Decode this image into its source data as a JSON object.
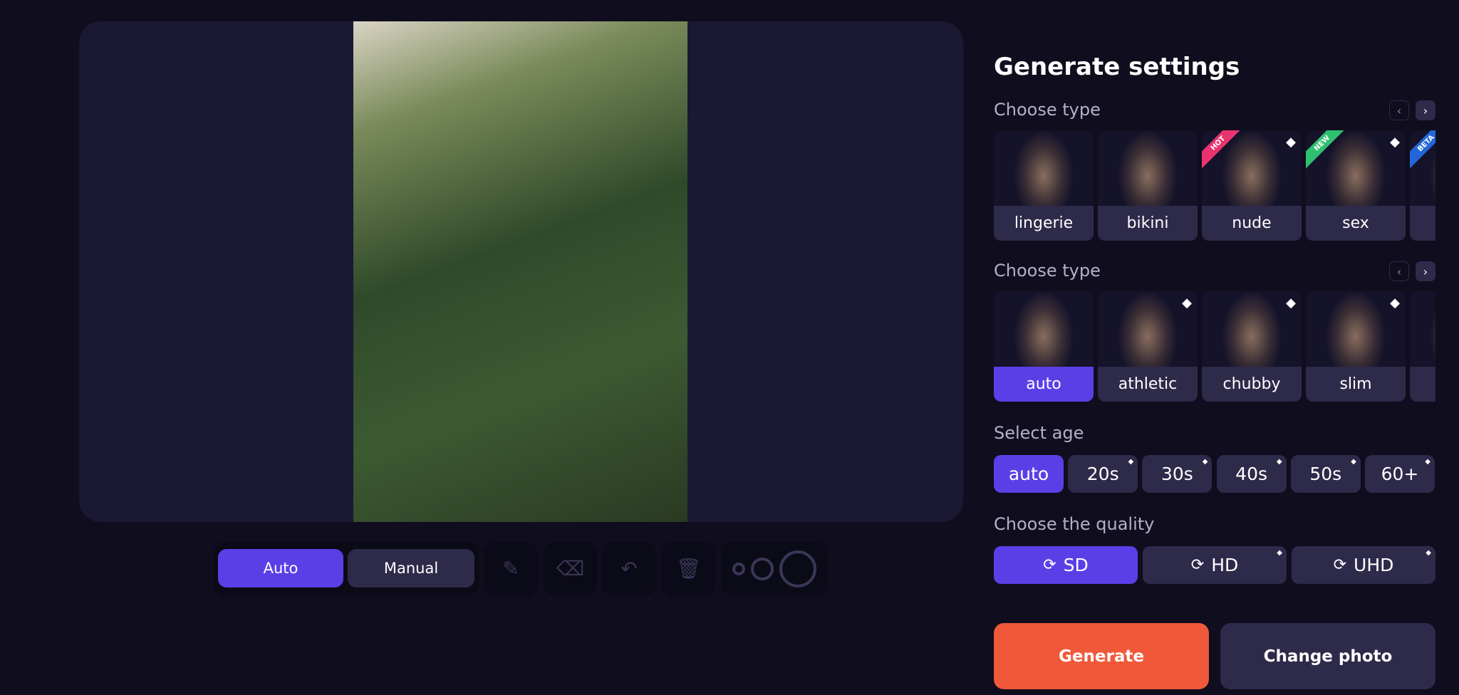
{
  "colors": {
    "accent": "#5b3fe6",
    "generate": "#f0583a",
    "hot": "#e8336f",
    "new": "#2fbf71",
    "beta": "#2266d8"
  },
  "editor": {
    "mode_auto": "Auto",
    "mode_manual": "Manual",
    "tools": [
      "brush-icon",
      "eraser-icon",
      "undo-icon",
      "trash-icon"
    ],
    "brush_sizes": [
      "small",
      "medium",
      "large"
    ]
  },
  "settings": {
    "title": "Generate settings",
    "type1": {
      "label": "Choose type",
      "items": [
        {
          "label": "lingerie",
          "premium": false,
          "badge": ""
        },
        {
          "label": "bikini",
          "premium": false,
          "badge": ""
        },
        {
          "label": "nude",
          "premium": true,
          "badge": "HOT"
        },
        {
          "label": "sex",
          "premium": true,
          "badge": "NEW"
        },
        {
          "label": "",
          "premium": false,
          "badge": "BETA"
        }
      ]
    },
    "type2": {
      "label": "Choose type",
      "selected": "auto",
      "items": [
        {
          "label": "auto",
          "premium": false
        },
        {
          "label": "athletic",
          "premium": true
        },
        {
          "label": "chubby",
          "premium": true
        },
        {
          "label": "slim",
          "premium": true
        },
        {
          "label": "",
          "premium": false
        }
      ]
    },
    "age": {
      "label": "Select age",
      "selected": "auto",
      "options": [
        "auto",
        "20s",
        "30s",
        "40s",
        "50s",
        "60+"
      ]
    },
    "quality": {
      "label": "Choose the quality",
      "selected": "SD",
      "options": [
        "SD",
        "HD",
        "UHD"
      ]
    },
    "generate": "Generate",
    "change_photo": "Change photo"
  }
}
